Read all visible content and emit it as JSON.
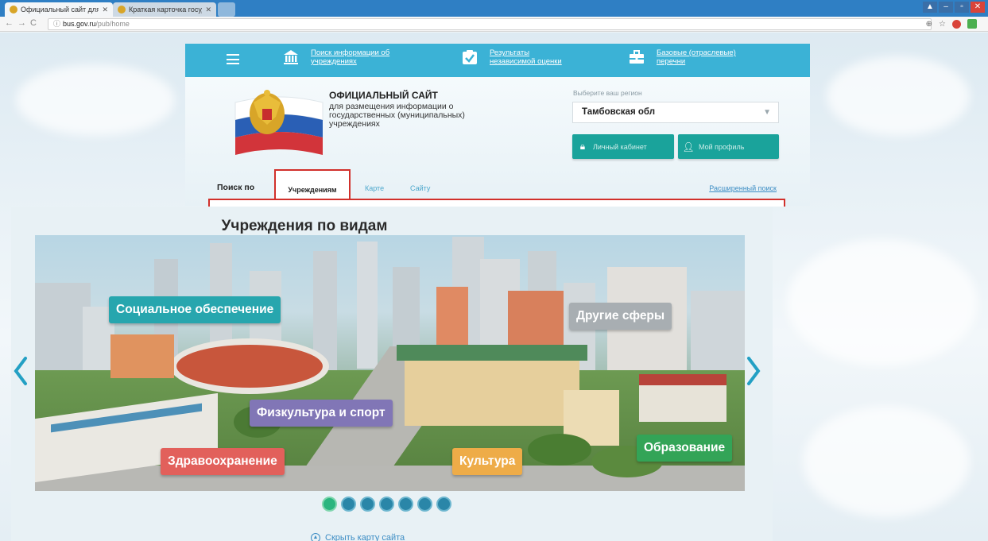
{
  "browser": {
    "tabs": [
      {
        "label": "Официальный сайт для",
        "active": true
      },
      {
        "label": "Краткая карточка госуд",
        "active": false
      }
    ],
    "url_host": "bus.gov.ru",
    "url_path": "/pub/home"
  },
  "topnav": {
    "items": [
      {
        "label": "Поиск информации об учреждениях",
        "icon": "building-icon"
      },
      {
        "label": "Результаты независимой оценки",
        "icon": "checkmark-icon"
      },
      {
        "label": "Базовые (отраслевые) перечни",
        "icon": "briefcase-icon"
      }
    ]
  },
  "header": {
    "site_title": "ОФИЦИАЛЬНЫЙ САЙТ",
    "site_subtitle": "для размещения информации о государственных (муниципальных) учреждениях",
    "region_label": "Выберите ваш регион",
    "region_value": "Тамбовская обл",
    "cabinet_button": "Личный кабинет",
    "profile_button": "Мой профиль"
  },
  "search": {
    "label": "Поиск по",
    "tabs": [
      "Учреждениям",
      "Карте",
      "Сайту"
    ],
    "active_tab": "Учреждениям",
    "advanced_link": "Расширенный поиск"
  },
  "carousel": {
    "title": "Учреждения по видам",
    "categories": [
      {
        "label": "Социальное обеспечение",
        "color": "#27a6ae"
      },
      {
        "label": "Другие сферы",
        "color": "#a8aeb2"
      },
      {
        "label": "Физкультура и спорт",
        "color": "#8176b6"
      },
      {
        "label": "Здравоохранение",
        "color": "#e2605b"
      },
      {
        "label": "Культура",
        "color": "#eeac48"
      },
      {
        "label": "Образование",
        "color": "#33a457"
      }
    ],
    "slide_count": 7,
    "active_slide": 1,
    "hide_map_link": "Скрыть карту сайта"
  }
}
